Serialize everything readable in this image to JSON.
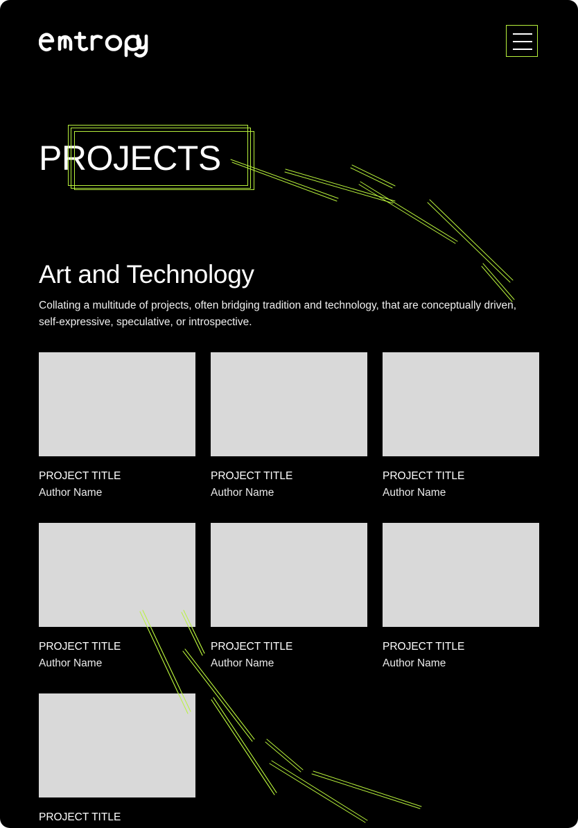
{
  "header": {
    "logo_text": "entropy",
    "menu_icon": "hamburger-menu-icon"
  },
  "page": {
    "title": "PROJECTS"
  },
  "section": {
    "heading": "Art and Technology",
    "description": "Collating a multitude of projects, often bridging tradition and technology, that are conceptually driven, self-expressive, speculative, or introspective."
  },
  "projects": [
    {
      "title": "PROJECT TITLE",
      "author": "Author Name"
    },
    {
      "title": "PROJECT TITLE",
      "author": "Author Name"
    },
    {
      "title": "PROJECT TITLE",
      "author": "Author Name"
    },
    {
      "title": "PROJECT TITLE",
      "author": "Author Name"
    },
    {
      "title": "PROJECT TITLE",
      "author": "Author Name"
    },
    {
      "title": "PROJECT TITLE",
      "author": "Author Name"
    },
    {
      "title": "PROJECT TITLE",
      "author": ""
    }
  ],
  "colors": {
    "background": "#000000",
    "accent": "#b8f23c",
    "thumbnail": "#d9d9d9",
    "text": "#ffffff"
  }
}
